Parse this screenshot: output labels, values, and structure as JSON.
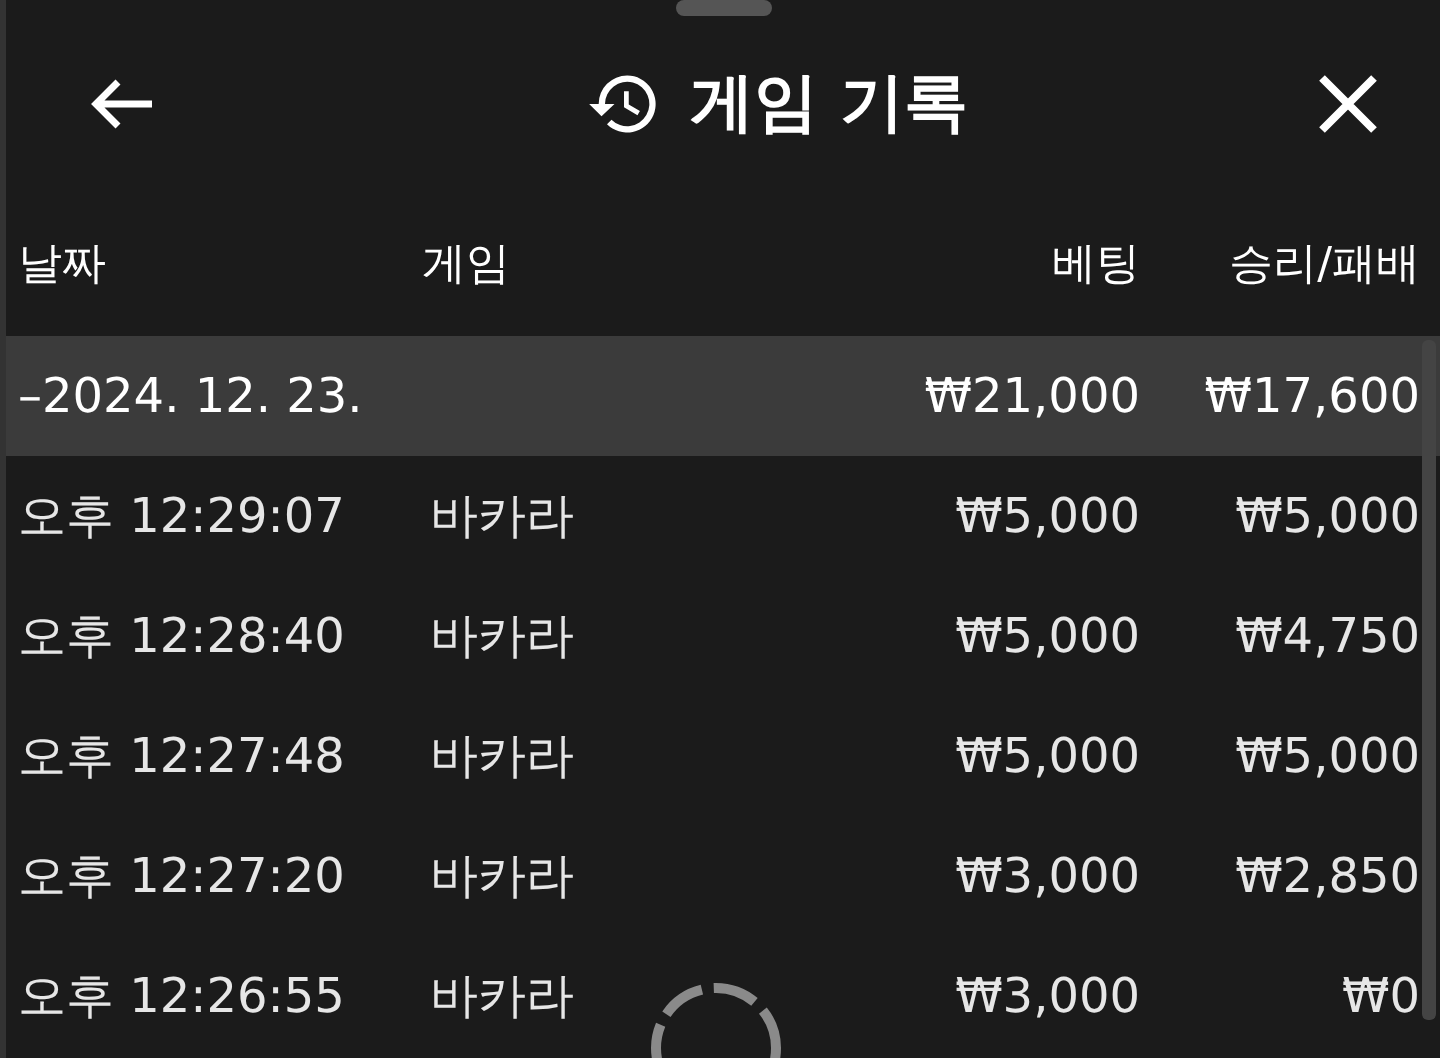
{
  "header": {
    "title": "게임 기록"
  },
  "table": {
    "columns": [
      "날짜",
      "게임",
      "베팅",
      "승리/패배"
    ],
    "group": {
      "date": "–2024. 12. 23.",
      "bet": "₩21,000",
      "result": "₩17,600"
    },
    "rows": [
      {
        "time": "오후 12:29:07",
        "game": "바카라",
        "bet": "₩5,000",
        "result": "₩5,000"
      },
      {
        "time": "오후 12:28:40",
        "game": "바카라",
        "bet": "₩5,000",
        "result": "₩4,750"
      },
      {
        "time": "오후 12:27:48",
        "game": "바카라",
        "bet": "₩5,000",
        "result": "₩5,000"
      },
      {
        "time": "오후 12:27:20",
        "game": "바카라",
        "bet": "₩3,000",
        "result": "₩2,850"
      },
      {
        "time": "오후 12:26:55",
        "game": "바카라",
        "bet": "₩3,000",
        "result": "₩0"
      }
    ]
  }
}
